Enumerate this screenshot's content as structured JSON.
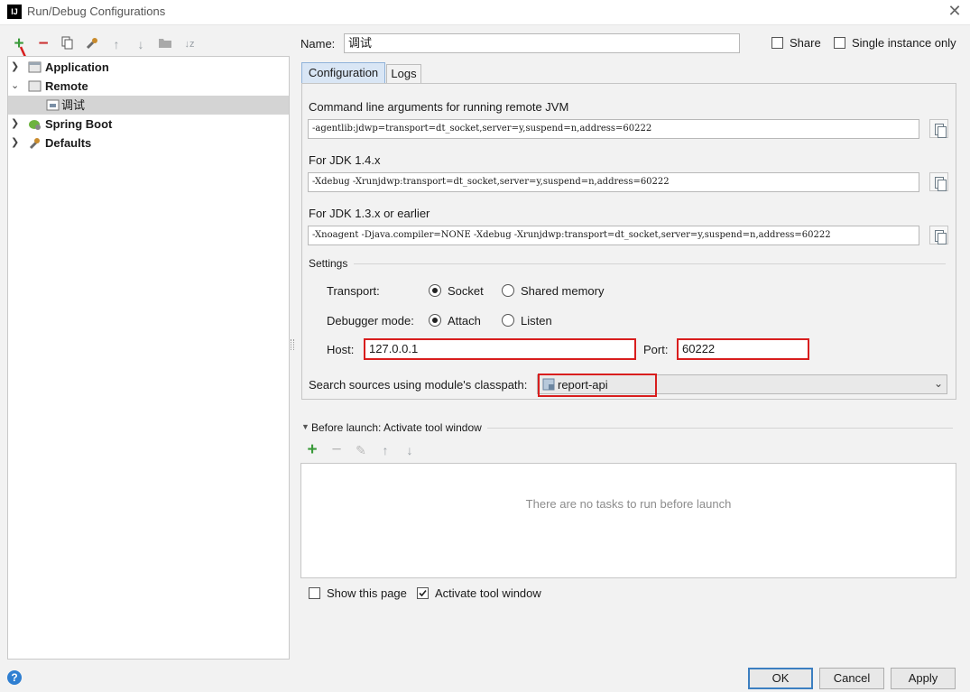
{
  "window": {
    "title": "Run/Debug Configurations",
    "app_icon": "IJ",
    "close": "✕"
  },
  "toolbar": {
    "icons": [
      "add-icon",
      "remove-icon",
      "copy-icon",
      "wrench-icon",
      "move-up-icon",
      "move-down-icon",
      "folder-icon",
      "sort-icon"
    ]
  },
  "tree": {
    "items": [
      {
        "label": "Application",
        "expanded": false
      },
      {
        "label": "Remote",
        "expanded": true
      },
      {
        "label": "调试",
        "selected": true
      },
      {
        "label": "Spring Boot",
        "expanded": false
      },
      {
        "label": "Defaults",
        "expanded": false
      }
    ]
  },
  "header": {
    "name_label": "Name:",
    "name_value": "调试",
    "share_label": "Share",
    "single_instance_label": "Single instance only"
  },
  "tabs": [
    {
      "label": "Configuration",
      "active": true
    },
    {
      "label": "Logs",
      "active": false
    }
  ],
  "config": {
    "cmd_label": "Command line arguments for running remote JVM",
    "cmd_value": "-agentlib:jdwp=transport=dt_socket,server=y,suspend=n,address=60222",
    "jdk14_label": "For JDK 1.4.x",
    "jdk14_value": "-Xdebug -Xrunjdwp:transport=dt_socket,server=y,suspend=n,address=60222",
    "jdk13_label": "For JDK 1.3.x or earlier",
    "jdk13_value": "-Xnoagent -Djava.compiler=NONE -Xdebug -Xrunjdwp:transport=dt_socket,server=y,suspend=n,address=60222",
    "settings_label": "Settings",
    "transport_label": "Transport:",
    "transport_opts": [
      "Socket",
      "Shared memory"
    ],
    "transport_selected": "Socket",
    "debugger_label": "Debugger mode:",
    "debugger_opts": [
      "Attach",
      "Listen"
    ],
    "debugger_selected": "Attach",
    "host_label": "Host:",
    "host_value": "127.0.0.1",
    "port_label": "Port:",
    "port_value": "60222",
    "classpath_label": "Search sources using module's classpath:",
    "classpath_value": "report-api"
  },
  "before_launch": {
    "title": "Before launch: Activate tool window",
    "empty_text": "There are no tasks to run before launch",
    "show_page_label": "Show this page",
    "show_page_checked": false,
    "activate_label": "Activate tool window",
    "activate_checked": true
  },
  "buttons": {
    "ok": "OK",
    "cancel": "Cancel",
    "apply": "Apply",
    "help": "?"
  },
  "colors": {
    "highlight_red": "#d81e1e",
    "add_green": "#3a9a3a",
    "remove_red": "#cc3333",
    "selection": "#d4d4d4"
  }
}
